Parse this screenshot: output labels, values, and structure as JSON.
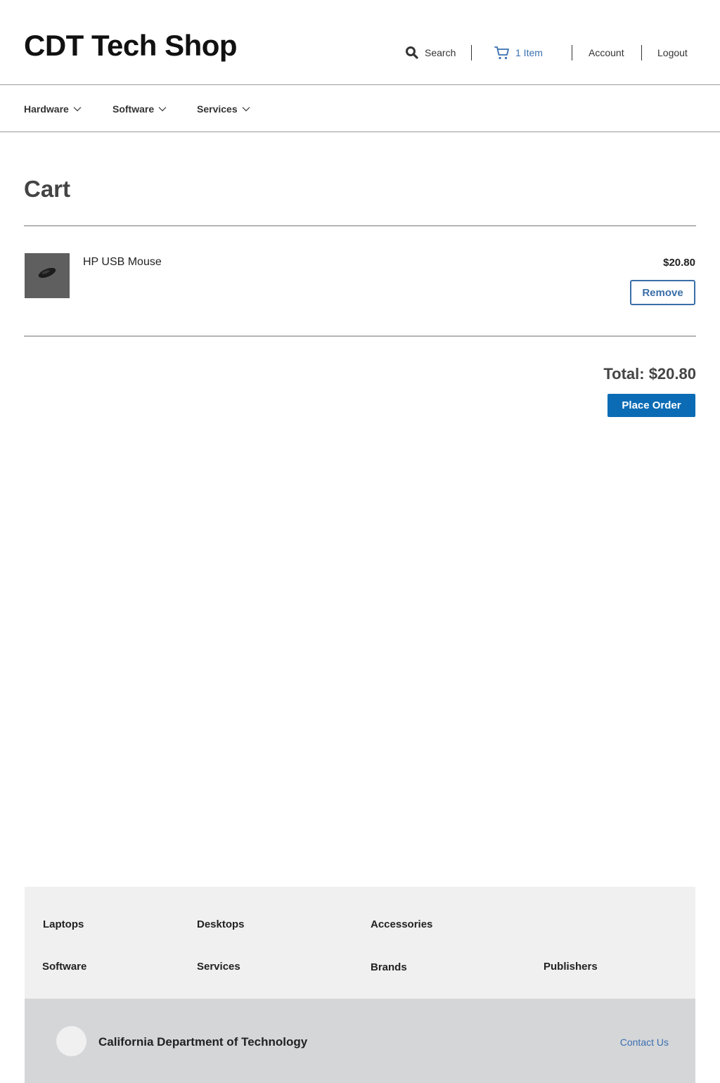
{
  "header": {
    "site_title": "CDT Tech Shop",
    "search_label": "Search",
    "cart_label": "1 Item",
    "account_label": "Account",
    "logout_label": "Logout"
  },
  "nav": {
    "items": [
      {
        "label": "Hardware"
      },
      {
        "label": "Software"
      },
      {
        "label": "Services"
      }
    ]
  },
  "main": {
    "page_title": "Cart",
    "cart_items": [
      {
        "name": "HP USB Mouse",
        "price": "$20.80",
        "remove_label": "Remove",
        "image_icon": "mouse-product-image"
      }
    ],
    "total_label": "Total: $20.80",
    "place_order_label": "Place Order"
  },
  "footer": {
    "links_row1": [
      "Laptops",
      "Desktops",
      "Accessories"
    ],
    "links_row2": [
      "Software",
      "Services",
      "Brands",
      "Publishers"
    ],
    "org_name": "California Department of Technology",
    "contact_label": "Contact Us"
  },
  "colors": {
    "accent_blue": "#0b6cb5",
    "link_blue": "#3a70b0",
    "footer_light": "#f0f0f0",
    "footer_dark": "#d5d6d8"
  }
}
